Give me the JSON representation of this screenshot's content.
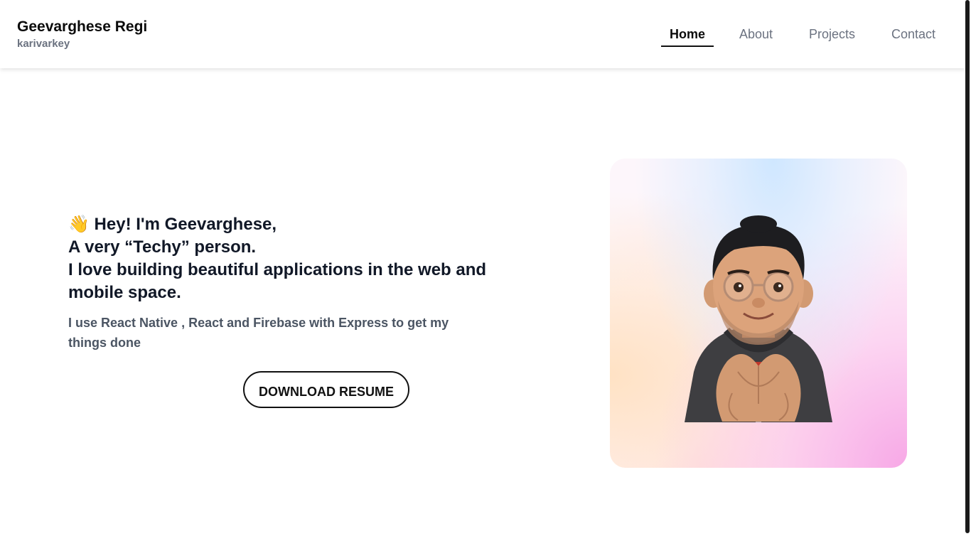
{
  "brand": {
    "name": "Geevarghese Regi",
    "handle": "karivarkey"
  },
  "nav": {
    "items": [
      {
        "label": "Home",
        "active": true
      },
      {
        "label": "About",
        "active": false
      },
      {
        "label": "Projects",
        "active": false
      },
      {
        "label": "Contact",
        "active": false
      }
    ]
  },
  "hero": {
    "line1": "👋 Hey! I'm Geevarghese,",
    "line2": "A very “Techy” person.",
    "line3": "I love building beautiful applications in the web and mobile space.",
    "subtext": "I use React Native , React and Firebase with Express to get my things done",
    "button_label": "DOWNLOAD RESUME"
  },
  "colors": {
    "text": "#111827",
    "muted": "#6b7280",
    "subtext": "#4b5563",
    "card_blue": "#cfe7ff",
    "card_pink": "#f7a8e6",
    "card_peach": "#ffe2c4"
  },
  "icons": {
    "avatar": "memoji-heart-hands-avatar"
  }
}
